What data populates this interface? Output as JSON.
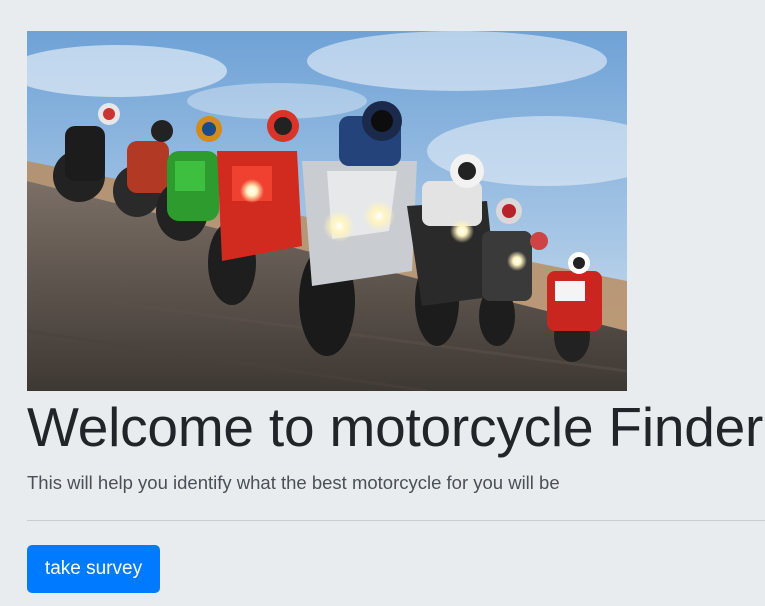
{
  "hero": {
    "image_icon": "motorcycle-racers-photo"
  },
  "main": {
    "title": "Welcome to motorcycle Finder",
    "lead": "This will help you identify what the best motorcycle for you will be",
    "button_label": "take survey"
  },
  "colors": {
    "background": "#e9ecef",
    "primary": "#007bff",
    "text": "#212529",
    "muted_text": "#495057"
  }
}
